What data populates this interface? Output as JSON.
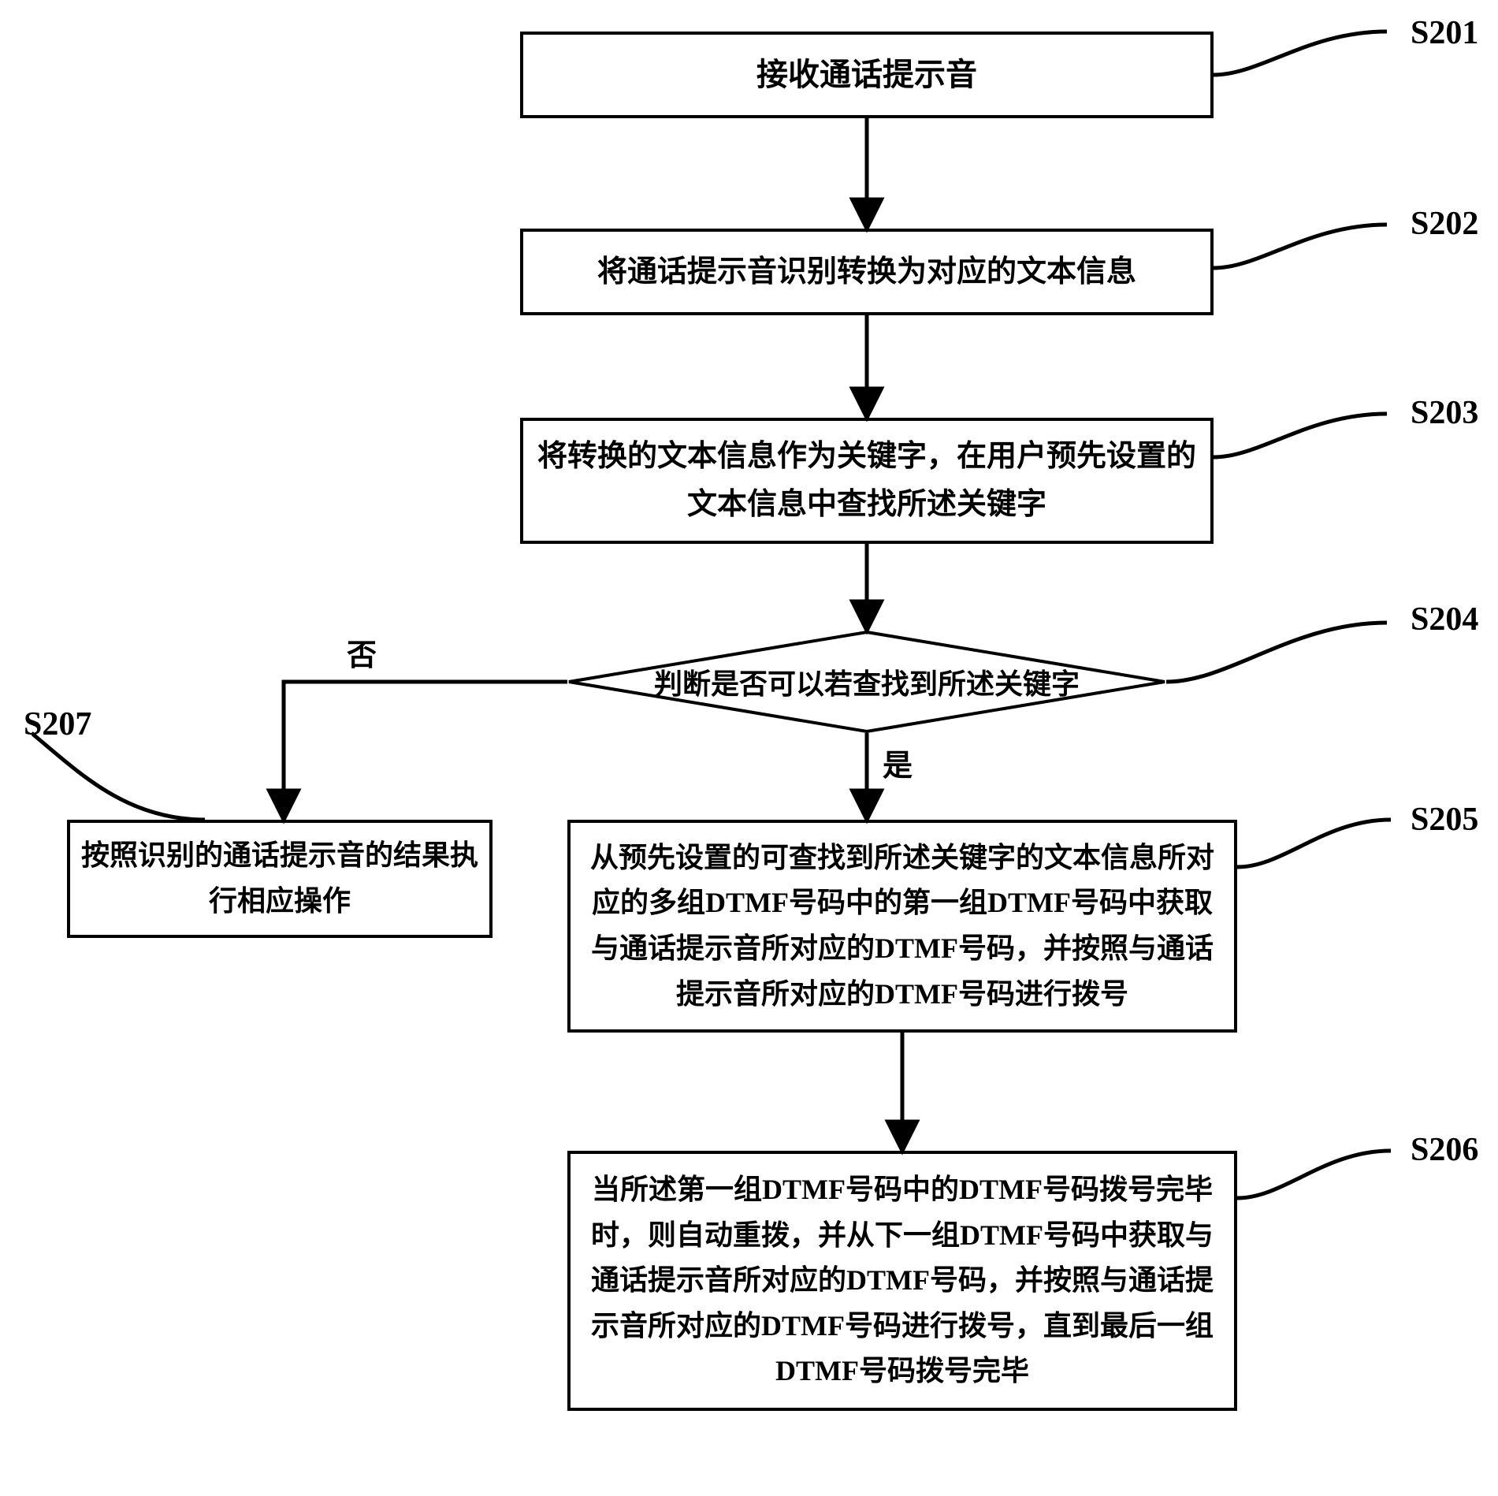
{
  "steps": {
    "s201_label": "S201",
    "s201_text": "接收通话提示音",
    "s202_label": "S202",
    "s202_text": "将通话提示音识别转换为对应的文本信息",
    "s203_label": "S203",
    "s203_text": "将转换的文本信息作为关键字，在用户预先设置的文本信息中查找所述关键字",
    "s204_label": "S204",
    "s204_text": "判断是否可以若查找到所述关键字",
    "s205_label": "S205",
    "s205_text": "从预先设置的可查找到所述关键字的文本信息所对应的多组DTMF号码中的第一组DTMF号码中获取与通话提示音所对应的DTMF号码，并按照与通话提示音所对应的DTMF号码进行拨号",
    "s206_label": "S206",
    "s206_text": "当所述第一组DTMF号码中的DTMF号码拨号完毕时，则自动重拨，并从下一组DTMF号码中获取与通话提示音所对应的DTMF号码，并按照与通话提示音所对应的DTMF号码进行拨号，直到最后一组DTMF号码拨号完毕",
    "s207_label": "S207",
    "s207_text": "按照识别的通话提示音的结果执行相应操作"
  },
  "branches": {
    "no": "否",
    "yes": "是"
  },
  "chart_data": {
    "type": "flowchart",
    "nodes": [
      {
        "id": "S201",
        "type": "process",
        "text": "接收通话提示音"
      },
      {
        "id": "S202",
        "type": "process",
        "text": "将通话提示音识别转换为对应的文本信息"
      },
      {
        "id": "S203",
        "type": "process",
        "text": "将转换的文本信息作为关键字，在用户预先设置的文本信息中查找所述关键字"
      },
      {
        "id": "S204",
        "type": "decision",
        "text": "判断是否可以若查找到所述关键字"
      },
      {
        "id": "S205",
        "type": "process",
        "text": "从预先设置的可查找到所述关键字的文本信息所对应的多组DTMF号码中的第一组DTMF号码中获取与通话提示音所对应的DTMF号码，并按照与通话提示音所对应的DTMF号码进行拨号"
      },
      {
        "id": "S206",
        "type": "process",
        "text": "当所述第一组DTMF号码中的DTMF号码拨号完毕时，则自动重拨，并从下一组DTMF号码中获取与通话提示音所对应的DTMF号码，并按照与通话提示音所对应的DTMF号码进行拨号，直到最后一组DTMF号码拨号完毕"
      },
      {
        "id": "S207",
        "type": "process",
        "text": "按照识别的通话提示音的结果执行相应操作"
      }
    ],
    "edges": [
      {
        "from": "S201",
        "to": "S202"
      },
      {
        "from": "S202",
        "to": "S203"
      },
      {
        "from": "S203",
        "to": "S204"
      },
      {
        "from": "S204",
        "to": "S205",
        "label": "是"
      },
      {
        "from": "S204",
        "to": "S207",
        "label": "否"
      },
      {
        "from": "S205",
        "to": "S206"
      }
    ]
  }
}
